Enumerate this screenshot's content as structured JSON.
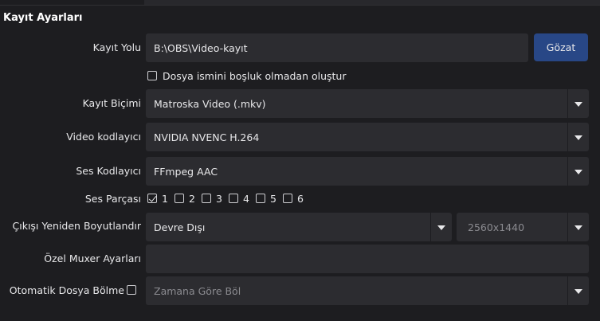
{
  "section_title": "Kayıt Ayarları",
  "rows": {
    "recording_path": {
      "label": "Kayıt Yolu",
      "value": "B:\\OBS\\Video-kayıt",
      "browse_label": "Gözat"
    },
    "no_space_filename": {
      "label": "Dosya ismini boşluk olmadan oluştur",
      "checked": false
    },
    "recording_format": {
      "label": "Kayıt Biçimi",
      "value": "Matroska Video (.mkv)"
    },
    "video_encoder": {
      "label": "Video kodlayıcı",
      "value": "NVIDIA NVENC H.264"
    },
    "audio_encoder": {
      "label": "Ses Kodlayıcı",
      "value": "FFmpeg AAC"
    },
    "audio_tracks": {
      "label": "Ses Parçası",
      "tracks": [
        {
          "label": "1",
          "checked": true
        },
        {
          "label": "2",
          "checked": false
        },
        {
          "label": "3",
          "checked": false
        },
        {
          "label": "4",
          "checked": false
        },
        {
          "label": "5",
          "checked": false
        },
        {
          "label": "6",
          "checked": false
        }
      ]
    },
    "rescale_output": {
      "label": "Çıkışı Yeniden Boyutlandır",
      "value": "Devre Dışı",
      "resolution": "2560x1440"
    },
    "custom_muxer": {
      "label": "Özel Muxer Ayarları",
      "value": ""
    },
    "auto_split": {
      "label": "Otomatik Dosya Bölme",
      "checked": false,
      "value": "Zamana Göre Böl"
    }
  },
  "colors": {
    "background": "#1d1d20",
    "field": "#2c2c30",
    "button": "#284786",
    "text": "#e8e8ea",
    "disabled_text": "#8b8b90"
  },
  "icons": {
    "dropdown": "chevron-down-icon",
    "checkbox_checked": "checkmark-icon"
  }
}
